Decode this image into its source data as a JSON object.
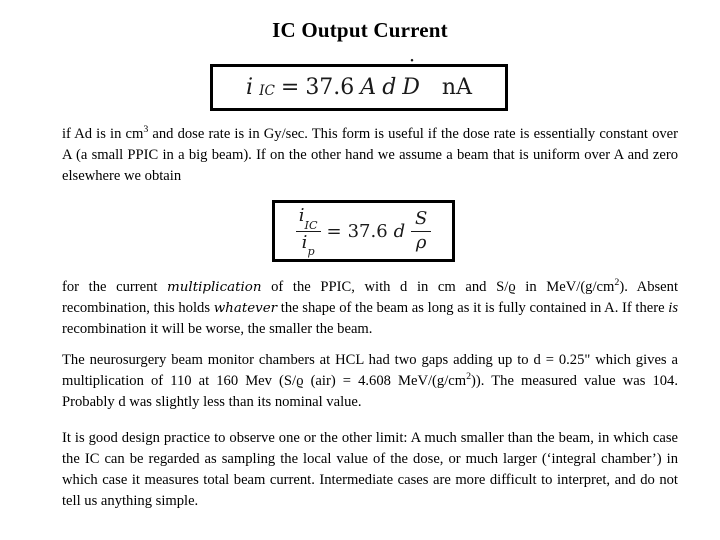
{
  "slide": {
    "title": "IC Output Current",
    "background_color": "#ffffff",
    "text_color": "#000000",
    "box_border_color": "#000000"
  },
  "equation1": {
    "lhs_symbol": "i",
    "lhs_subscript": "IC",
    "relation": "=",
    "coefficient": "37.6",
    "var_a": "A",
    "var_d": "d",
    "var_ddot": "D",
    "units": "nA",
    "plain": "i_IC = 37.6 A d Ḋ  nA"
  },
  "equation2": {
    "num_symbol": "i",
    "num_subscript": "IC",
    "den_symbol": "i",
    "den_subscript": "p",
    "relation": "=",
    "coefficient": "37.6",
    "var_d": "d",
    "frac_num": "S",
    "frac_den": "ρ",
    "plain": "i_IC / i_p = 37.6 d S/ρ"
  },
  "paragraph1": {
    "seg1": "if Ad is in cm",
    "sup1": "3",
    "seg2": " and dose rate is in Gy/sec. This form is useful if the dose rate is essentially constant over A (a small PPIC in a big beam). If on the other hand we assume a beam that is uniform over A and zero elsewhere we obtain"
  },
  "paragraph2": {
    "seg1": "for the current ",
    "emph1": "multiplication",
    "seg2": "  of the PPIC, with d  in cm and S/ϱ  in MeV/(g/cm",
    "sup1": "2",
    "seg3": "). Absent recombination, this holds ",
    "emph2": "whatever",
    "seg4": "  the shape of the beam as long as it is fully contained in A. If there ",
    "emph3": "is",
    "seg5": " recombination it will be worse, the smaller the beam."
  },
  "paragraph3": {
    "seg1": "The neurosurgery beam monitor chambers at HCL had two gaps adding up to d = 0.25\" which gives a multiplication of 110 at 160 Mev (S/ϱ (air)  = 4.608 MeV/(g/cm",
    "sup1": "2",
    "seg2": ")). The measured value was 104. Probably d was slightly less than its nominal value."
  },
  "paragraph4": {
    "seg1": "It is good design practice to observe one or the other limit: A much smaller than the beam, in which case the IC can be regarded as sampling the local value of the dose, or much larger (‘integral chamber’) in which case it measures total beam current. Intermediate cases are more difficult to interpret, and do not tell us anything simple."
  }
}
